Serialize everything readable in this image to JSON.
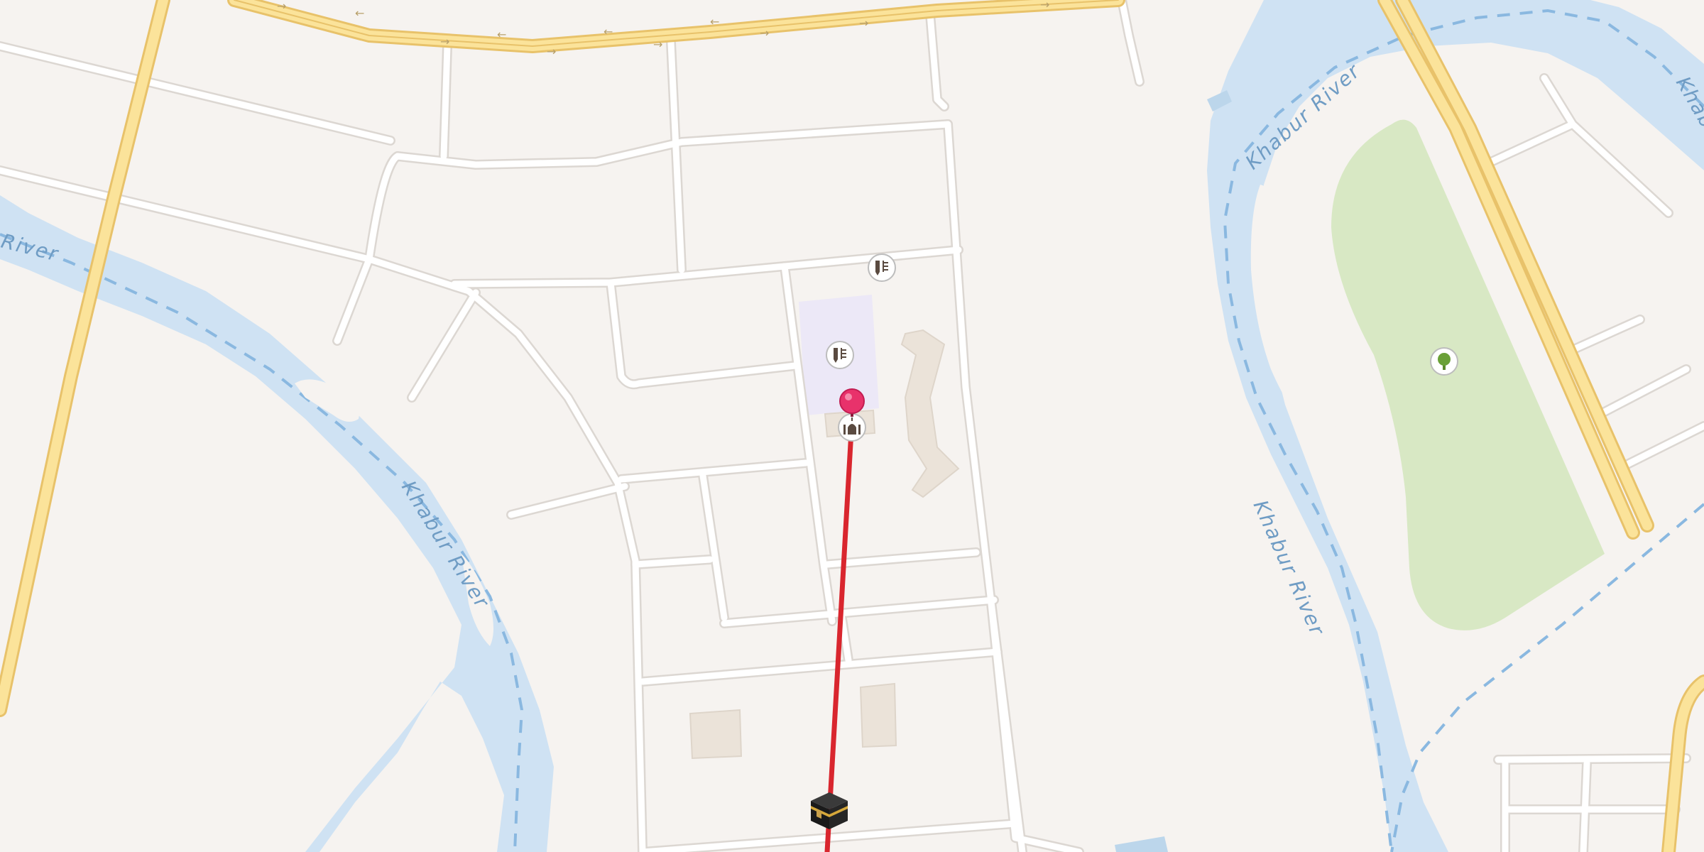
{
  "map": {
    "river_name": "Khabur River",
    "labels": [
      {
        "id": "river-label-west",
        "text": "River"
      },
      {
        "id": "river-label-center",
        "text": "Khabur River"
      },
      {
        "id": "river-label-north",
        "text": "Khabur River"
      },
      {
        "id": "river-label-east-mid",
        "text": "Khabur River"
      },
      {
        "id": "river-label-ne",
        "text": "Khab"
      }
    ],
    "pois": [
      {
        "id": "school-poi-north",
        "icon": "school-icon"
      },
      {
        "id": "school-poi-mid",
        "icon": "school-icon"
      },
      {
        "id": "mosque-poi",
        "icon": "mosque-icon"
      },
      {
        "id": "park-poi",
        "icon": "tree-icon"
      },
      {
        "id": "kaaba-marker",
        "icon": "kaaba-icon"
      }
    ],
    "location_pin": {
      "icon": "location-pin-icon",
      "color": "#e8326b"
    },
    "qibla_line": {
      "color": "#d9262e"
    },
    "colors": {
      "land": "#f6f3f0",
      "water": "#cfe2f3",
      "water_line": "#8ab8e0",
      "major_road": "#fbe39a",
      "major_road_casing": "#e8c26a",
      "minor_road": "#ffffff",
      "minor_road_casing": "#dcd7d2",
      "park": "#d8e8c4",
      "school_area": "#ece8f7",
      "building": "#ebe3d9"
    }
  }
}
